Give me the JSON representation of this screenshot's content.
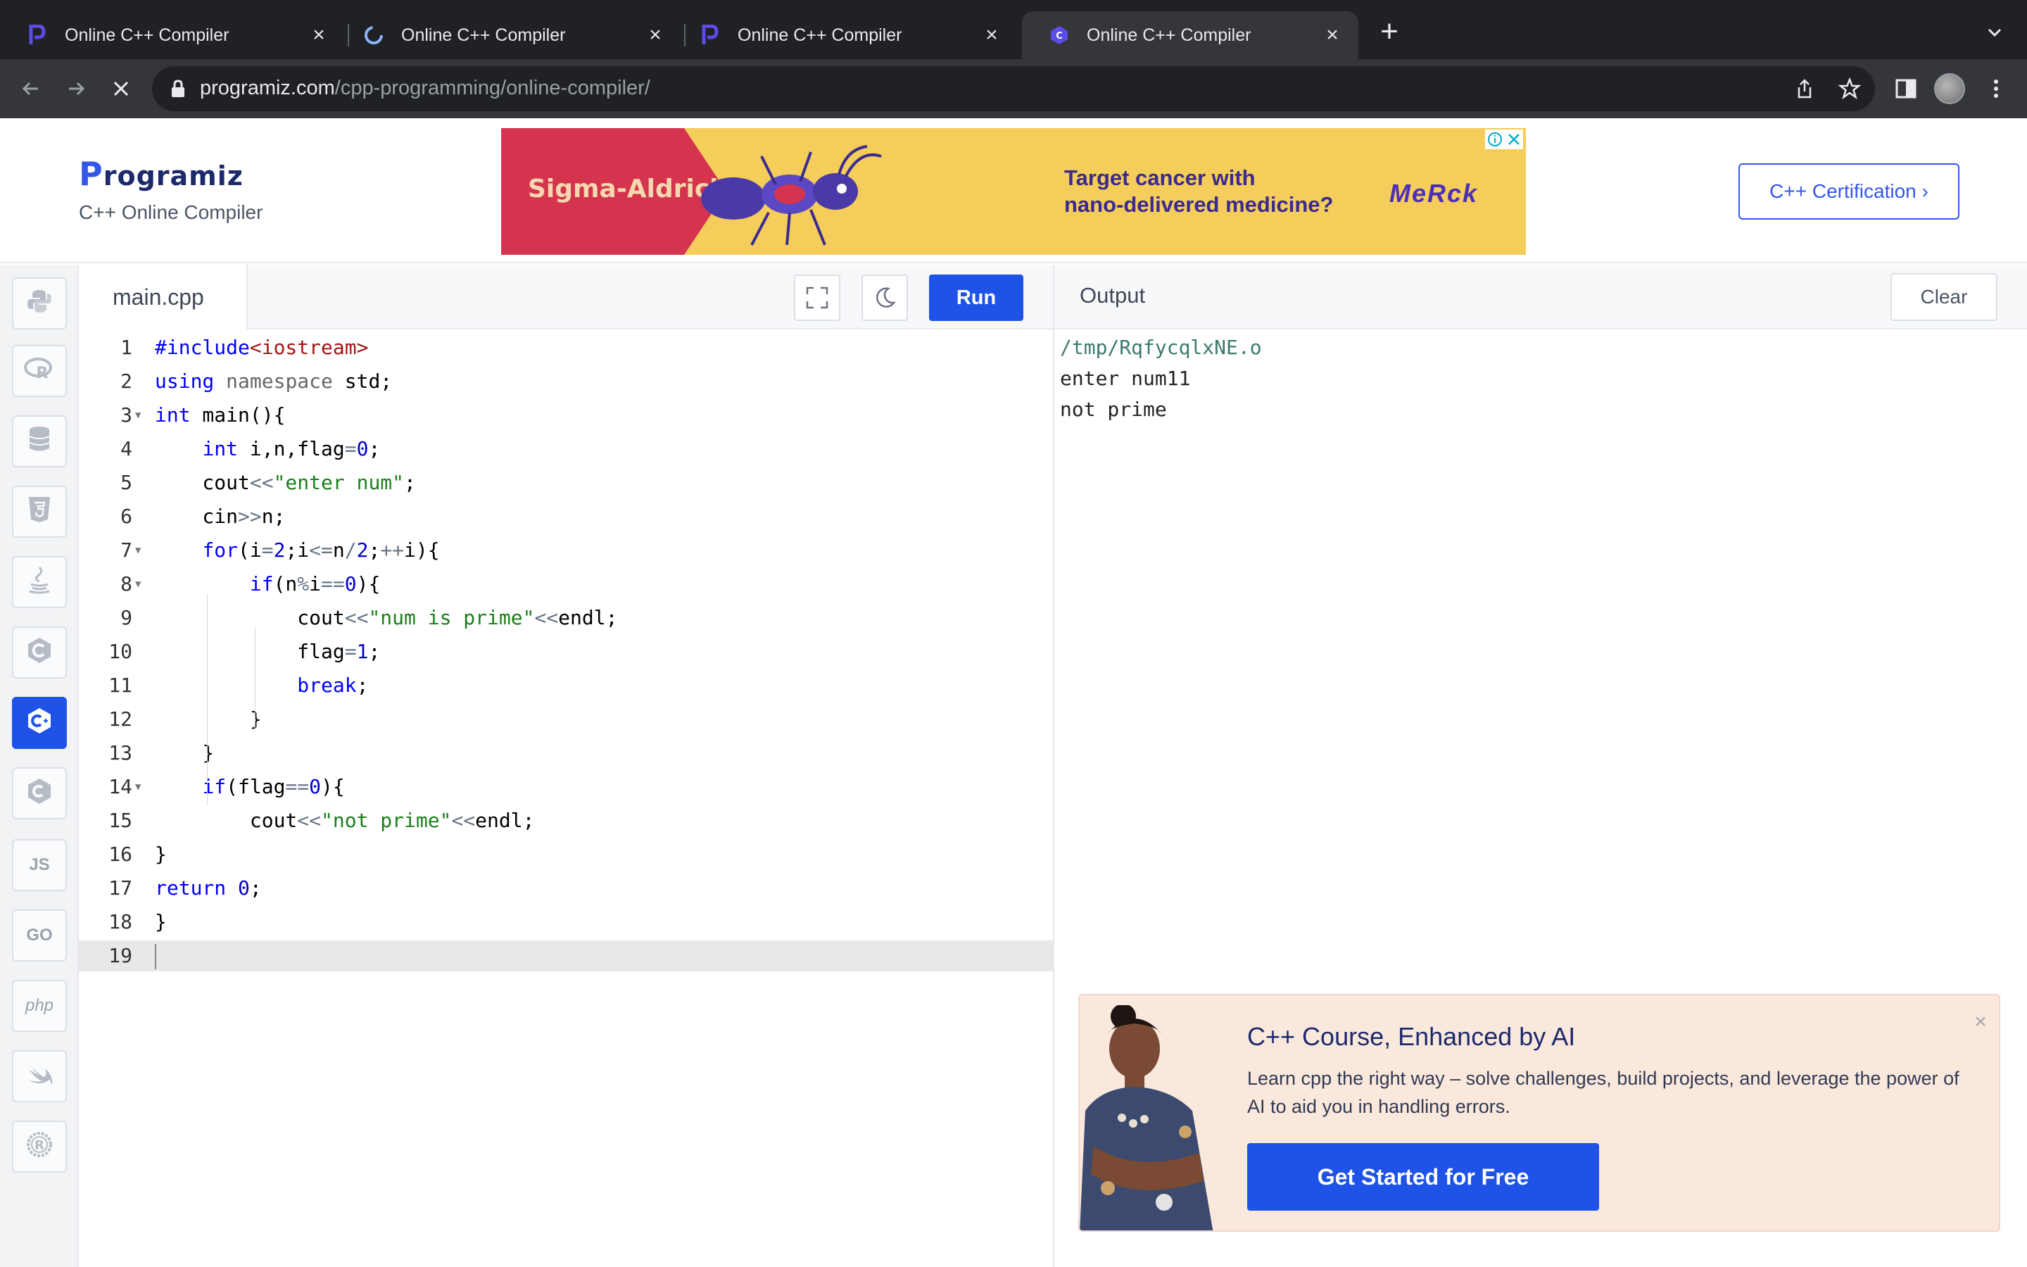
{
  "browser": {
    "tabs": [
      {
        "title": "Online C++ Compiler",
        "favicon": "programiz-p-icon"
      },
      {
        "title": "Online C++ Compiler",
        "favicon": "loading-spinner-icon"
      },
      {
        "title": "Online C++ Compiler",
        "favicon": "programiz-p-icon"
      },
      {
        "title": "Online C++ Compiler",
        "favicon": "cpp-logo-icon",
        "active": true
      }
    ],
    "close_glyph": "×",
    "new_tab_glyph": "+",
    "url_host": "programiz.com",
    "url_path": "/cpp-programming/online-compiler/"
  },
  "site": {
    "logo_text": "rogramiz",
    "logo_initial": "P",
    "subtitle": "C++ Online Compiler",
    "certification_label": "C++ Certification ›",
    "ad": {
      "brand": "Sigma-Aldrich.",
      "headline": "Target cancer with\nnano-delivered medicine?",
      "logo": "MeRck"
    }
  },
  "languages": [
    {
      "name": "python-icon",
      "label": ""
    },
    {
      "name": "r-icon",
      "label": ""
    },
    {
      "name": "sql-icon",
      "label": ""
    },
    {
      "name": "html5-icon",
      "label": ""
    },
    {
      "name": "java-icon",
      "label": ""
    },
    {
      "name": "c-icon",
      "label": ""
    },
    {
      "name": "cpp-icon",
      "label": "",
      "active": true
    },
    {
      "name": "csharp-icon",
      "label": ""
    },
    {
      "name": "js-icon",
      "label": "JS"
    },
    {
      "name": "go-icon",
      "label": "GO"
    },
    {
      "name": "php-icon",
      "label": "php"
    },
    {
      "name": "swift-icon",
      "label": ""
    },
    {
      "name": "rust-icon",
      "label": ""
    }
  ],
  "editor": {
    "filename": "main.cpp",
    "run_label": "Run",
    "line_numbers": [
      "1",
      "2",
      "3",
      "4",
      "5",
      "6",
      "7",
      "8",
      "9",
      "10",
      "11",
      "12",
      "13",
      "14",
      "15",
      "16",
      "17",
      "18",
      "19"
    ],
    "lines": [
      "#include<iostream>",
      "using namespace std;",
      "int main(){",
      "    int i,n,flag=0;",
      "    cout<<\"enter num\";",
      "    cin>>n;",
      "    for(i=2;i<=n/2;++i){",
      "        if(n%i==0){",
      "            cout<<\"num is prime\"<<endl;",
      "            flag=1;",
      "            break;",
      "        }",
      "    }",
      "    if(flag==0){",
      "        cout<<\"not prime\"<<endl;",
      "}",
      "return 0;",
      "}",
      ""
    ]
  },
  "output": {
    "title": "Output",
    "clear_label": "Clear",
    "lines": [
      "/tmp/RqfycqlxNE.o",
      "enter num11",
      "not prime"
    ]
  },
  "promo": {
    "title": "C++ Course, Enhanced by AI",
    "description": "Learn cpp the right way – solve challenges, build projects, and leverage the power of AI to aid you in handling errors.",
    "cta": "Get Started for Free",
    "close_glyph": "×"
  }
}
